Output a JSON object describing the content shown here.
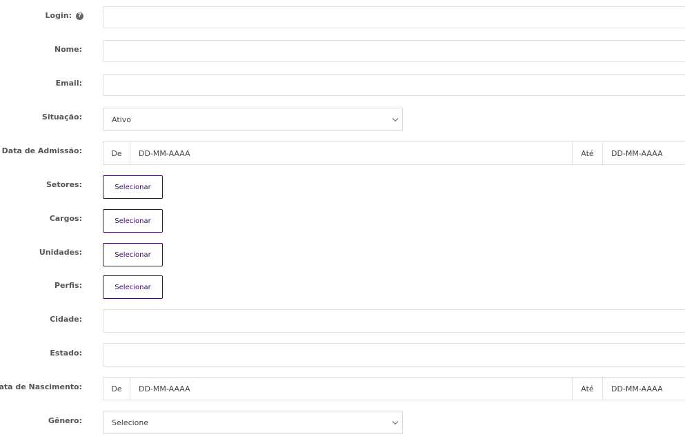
{
  "fields": {
    "login": {
      "label": "Login:",
      "help_icon": "question-circle-icon"
    },
    "nome": {
      "label": "Nome:"
    },
    "email": {
      "label": "Email:"
    },
    "situacao": {
      "label": "Situação:",
      "value": "Ativo"
    },
    "data_admissao": {
      "label": "Data de Admissão:",
      "from_label": "De",
      "from_placeholder": "DD-MM-AAAA",
      "to_label": "Até",
      "to_placeholder": "DD-MM-AAAA"
    },
    "setores": {
      "label": "Setores:",
      "button": "Selecionar"
    },
    "cargos": {
      "label": "Cargos:",
      "button": "Selecionar"
    },
    "unidades": {
      "label": "Unidades:",
      "button": "Selecionar"
    },
    "perfis": {
      "label": "Perfis:",
      "button": "Selecionar"
    },
    "cidade": {
      "label": "Cidade:"
    },
    "estado": {
      "label": "Estado:"
    },
    "data_nascimento": {
      "label": "Data de Nascimento:",
      "from_label": "De",
      "from_placeholder": "DD-MM-AAAA",
      "to_label": "Até",
      "to_placeholder": "DD-MM-AAAA"
    },
    "genero": {
      "label": "Gênero:",
      "value": "Selecione"
    }
  },
  "colors": {
    "accent": "#3d0b63",
    "border": "#e0e0e0",
    "label": "#555555"
  }
}
